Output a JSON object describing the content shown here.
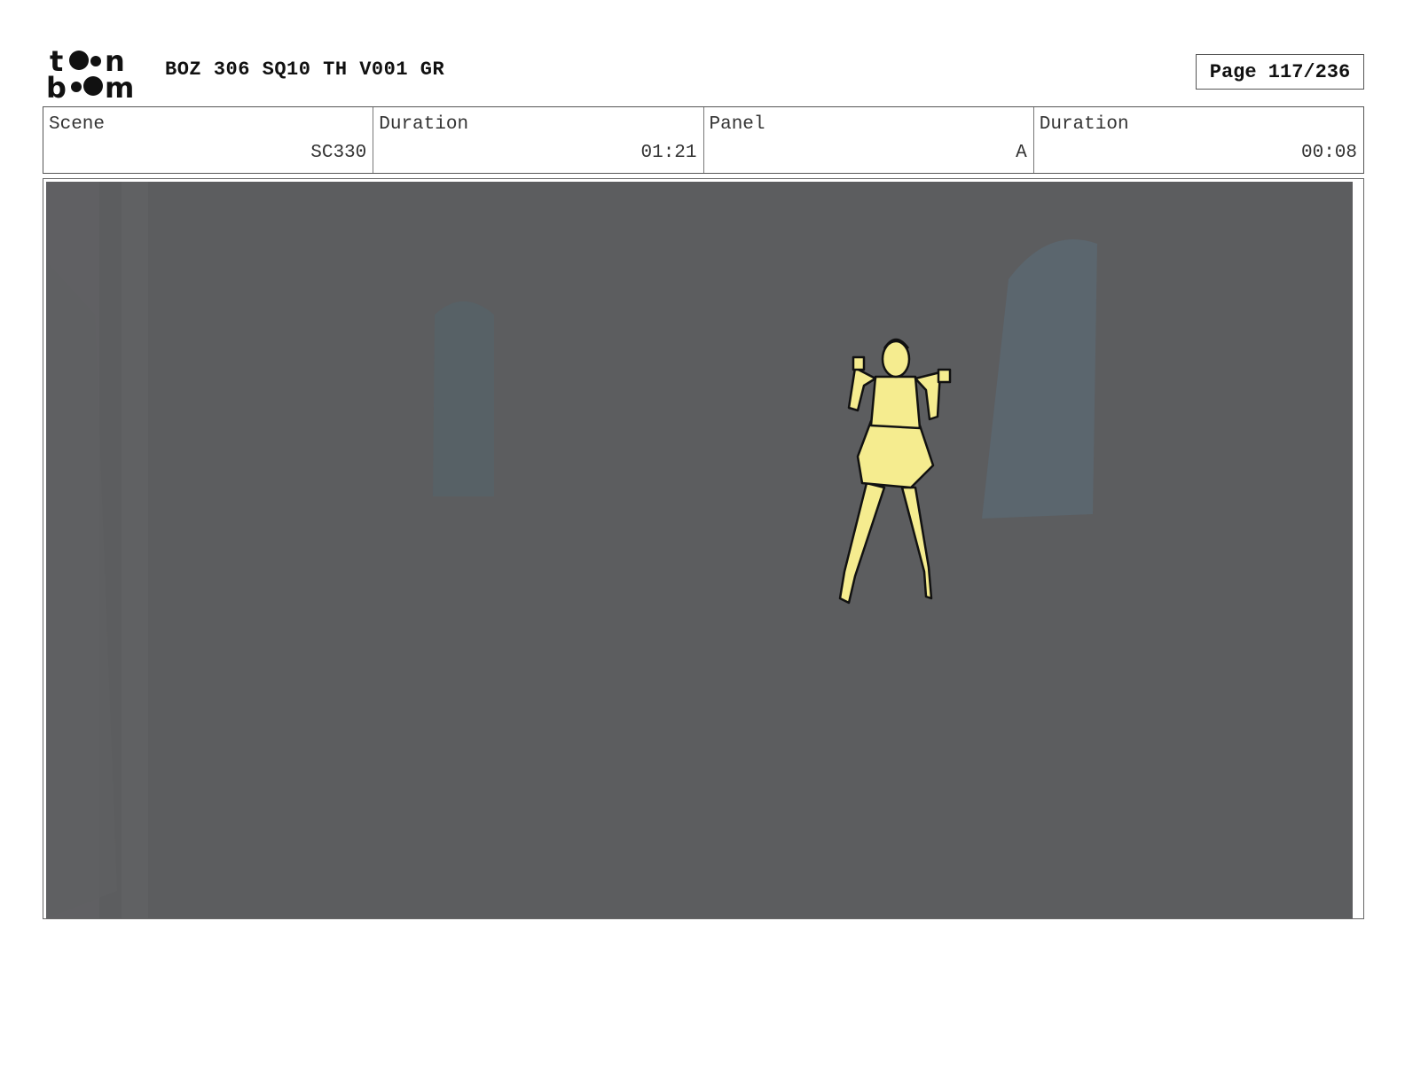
{
  "header": {
    "logo_text": "toon boom",
    "title": "BOZ 306 SQ10 TH V001 GR",
    "page_label": "Page 117/236"
  },
  "info": {
    "scene_label": "Scene",
    "scene_value": "SC330",
    "scene_duration_label": "Duration",
    "scene_duration_value": "01:21",
    "panel_label": "Panel",
    "panel_value": "A",
    "panel_duration_label": "Duration",
    "panel_duration_value": "00:08"
  },
  "panel": {
    "background_color": "#5c5d5f",
    "character_color": "#f5ec8f"
  }
}
